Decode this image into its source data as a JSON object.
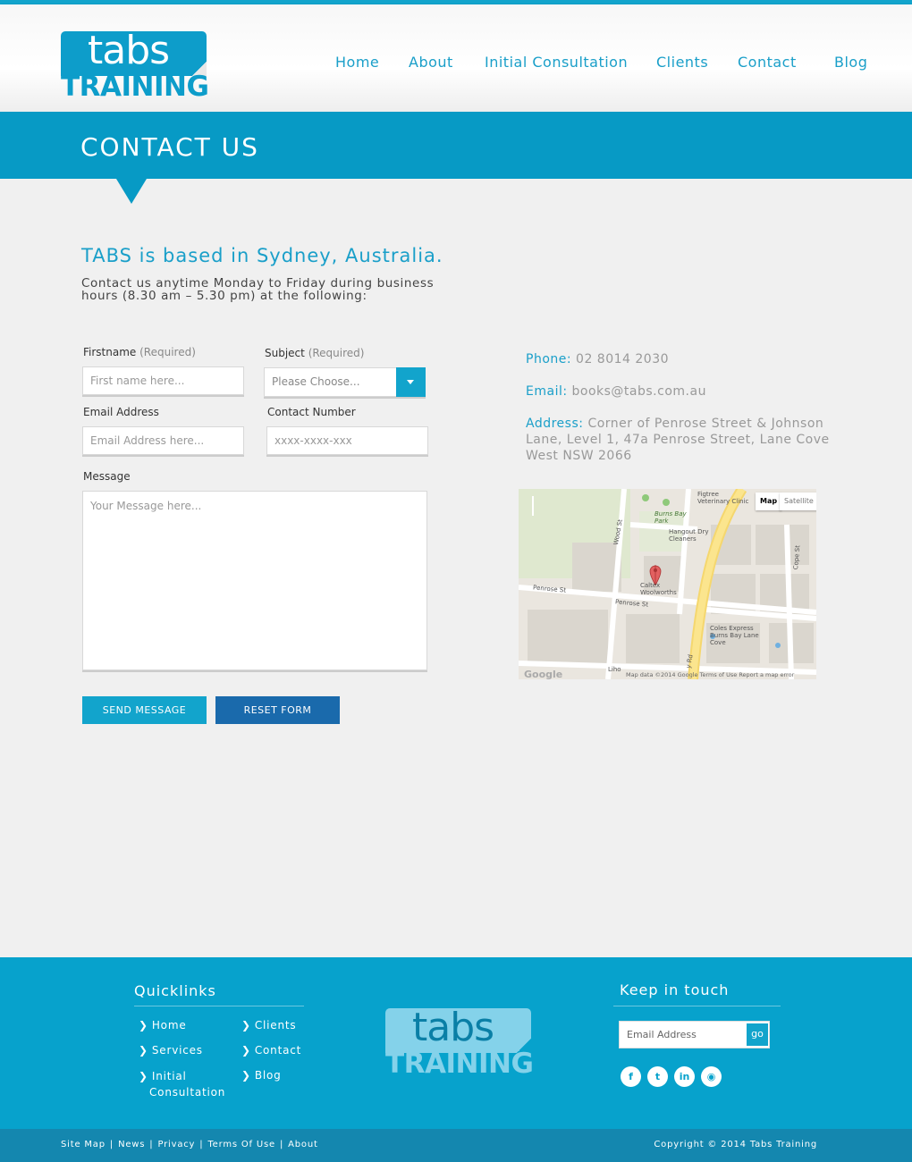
{
  "brand": {
    "logo_top": "tabs",
    "logo_bottom": "TRAINING",
    "accent": "#079ac5",
    "dark_button": "#1a6aac"
  },
  "nav": {
    "items": [
      {
        "label": "Home"
      },
      {
        "label": "About"
      },
      {
        "label": "Initial Consultation"
      },
      {
        "label": "Clients"
      },
      {
        "label": "Contact"
      },
      {
        "label": "Blog"
      }
    ]
  },
  "page": {
    "title": "CONTACT US",
    "intro_heading": "TABS is based in Sydney, Australia.",
    "intro_text": "Contact us anytime Monday to Friday during business hours (8.30 am – 5.30 pm) at the following:"
  },
  "form": {
    "firstname_label": "Firstname",
    "firstname_required": "(Required)",
    "firstname_placeholder": "First name here...",
    "subject_label": "Subject",
    "subject_required": "(Required)",
    "subject_value": "Please Choose...",
    "email_label": "Email Address",
    "email_placeholder": "Email Address here...",
    "contact_label": "Contact Number",
    "contact_placeholder": "xxxx-xxxx-xxx",
    "message_label": "Message",
    "message_placeholder": "Your Message here...",
    "send_label": "SEND MESSAGE",
    "reset_label": "RESET FORM"
  },
  "info": {
    "phone_key": "Phone:",
    "phone_value": "02 8014 2030",
    "email_key": "Email:",
    "email_value": "books@tabs.com.au",
    "address_key": "Address:",
    "address_value": "Corner of Penrose Street & Johnson Lane, Level 1, 47a Penrose Street, Lane Cove West NSW 2066"
  },
  "map": {
    "btn_map": "Map",
    "btn_satellite": "Satellite",
    "labels": {
      "figtree": "Figtree Veterinary Clinic",
      "burns_bay_park": "Burns Bay Park",
      "hangout": "Hangout Dry Cleaners",
      "wood_st": "Wood St",
      "caltex": "Caltex Woolworths",
      "penrose_1": "Penrose St",
      "penrose_2": "Penrose St",
      "cope_st": "Cope St",
      "coles": "Coles Express Burns Bay Lane Cove",
      "rd": "y Rd",
      "liho": "Liho"
    },
    "google": "Google",
    "footer_text": "Map data ©2014 Google    Terms of Use    Report a map error"
  },
  "footer": {
    "quicklinks_title": "Quicklinks",
    "quicklinks_col1": [
      "Home",
      "Services",
      "Initial Consultation"
    ],
    "quicklinks_col2": [
      "Clients",
      "Contact",
      "Blog"
    ],
    "keep_in_touch_title": "Keep in touch",
    "subscribe_placeholder": "Email Address",
    "subscribe_button": "go",
    "social": [
      {
        "icon": "facebook-icon",
        "glyph": "f"
      },
      {
        "icon": "twitter-icon",
        "glyph": "t"
      },
      {
        "icon": "linkedin-icon",
        "glyph": "in"
      },
      {
        "icon": "rss-icon",
        "glyph": "◉"
      }
    ],
    "bottom_links": [
      "Site Map",
      "News",
      "Privacy",
      "Terms Of Use",
      "About"
    ],
    "copyright": "Copyright © 2014 Tabs Training"
  }
}
